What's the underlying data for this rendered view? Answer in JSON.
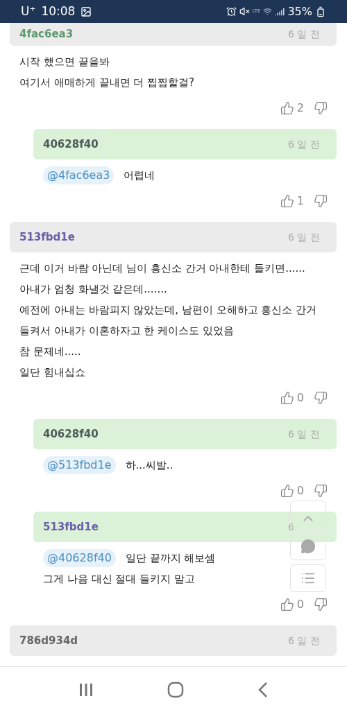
{
  "status_bar": {
    "carrier": "U⁺",
    "time": "10:08",
    "network": "LTE",
    "battery": "35%"
  },
  "comments": [
    {
      "kind": "comment",
      "author": "4fac6ea3",
      "color": "#5f9a6e",
      "time": "6 일 전",
      "lines": [
        "시작 했으면 끝을봐",
        "여기서 애매하게 끝내면 더 찝찝할걸?"
      ],
      "likes": "2"
    },
    {
      "kind": "reply",
      "author": "40628f40",
      "color": "#4f5b5b",
      "time": "6 일 전",
      "mention": "@4fac6ea3",
      "lines": [
        "어렵네"
      ],
      "likes": "1"
    },
    {
      "kind": "comment",
      "author": "513fbd1e",
      "color": "#6a5fa8",
      "time": "6 일 전",
      "lines": [
        "근데 이거 바람 아닌데 님이 흥신소 간거 아내한테 들키면......",
        "아내가 엄청 화낼것 같은데.......",
        "예전에 아내는 바람피지 않았는데, 남편이 오해하고 흥신소 간거 들켜서 아내가 이혼하자고 한 케이스도 있었음",
        "참 문제네.....",
        "일단 힘내십쇼"
      ],
      "likes": "0"
    },
    {
      "kind": "reply",
      "author": "40628f40",
      "color": "#4f5b5b",
      "time": "6 일 전",
      "mention": "@513fbd1e",
      "lines": [
        "하...씨발.."
      ],
      "likes": "0"
    },
    {
      "kind": "reply",
      "author": "513fbd1e",
      "color": "#6a5fa8",
      "time": "6",
      "mention": "@40628f40",
      "lines": [
        "일단 끝까지 해보셈",
        "그게 나음 대신 절대 들키지 말고"
      ],
      "likes": "0"
    },
    {
      "kind": "comment",
      "author": "786d934d",
      "color": "#666666",
      "time": "6 일 전"
    }
  ]
}
